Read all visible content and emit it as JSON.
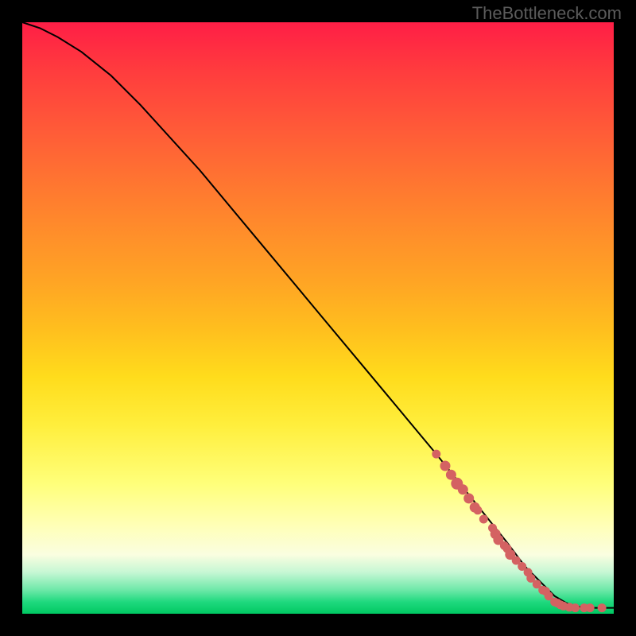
{
  "watermark": "TheBottleneck.com",
  "chart_data": {
    "type": "line",
    "title": "",
    "xlabel": "",
    "ylabel": "",
    "xlim": [
      0,
      100
    ],
    "ylim": [
      0,
      100
    ],
    "curve": {
      "name": "bottleneck-curve",
      "x": [
        0,
        3,
        6,
        10,
        15,
        20,
        30,
        40,
        50,
        60,
        70,
        78,
        82,
        85,
        88,
        90,
        92,
        94,
        96,
        98,
        100
      ],
      "y": [
        100,
        99,
        97.5,
        95,
        91,
        86,
        75,
        63,
        51,
        39,
        27,
        17,
        12,
        8,
        5,
        3,
        1.8,
        1.2,
        1,
        1,
        1
      ]
    },
    "scatter": {
      "name": "sample-points",
      "points": [
        {
          "x": 70,
          "y": 27,
          "r": 5
        },
        {
          "x": 71.5,
          "y": 25,
          "r": 6
        },
        {
          "x": 72.5,
          "y": 23.5,
          "r": 6
        },
        {
          "x": 73.5,
          "y": 22,
          "r": 7
        },
        {
          "x": 74.5,
          "y": 21,
          "r": 6
        },
        {
          "x": 75.5,
          "y": 19.5,
          "r": 6
        },
        {
          "x": 76.5,
          "y": 18,
          "r": 6
        },
        {
          "x": 77,
          "y": 17.5,
          "r": 5
        },
        {
          "x": 78,
          "y": 16,
          "r": 5
        },
        {
          "x": 79.5,
          "y": 14.5,
          "r": 5
        },
        {
          "x": 80,
          "y": 13.5,
          "r": 6
        },
        {
          "x": 80.5,
          "y": 12.5,
          "r": 6
        },
        {
          "x": 81.5,
          "y": 11.5,
          "r": 5
        },
        {
          "x": 82,
          "y": 11,
          "r": 5
        },
        {
          "x": 82.5,
          "y": 10,
          "r": 6
        },
        {
          "x": 83.5,
          "y": 9,
          "r": 5
        },
        {
          "x": 84.5,
          "y": 8,
          "r": 5
        },
        {
          "x": 85.5,
          "y": 7,
          "r": 5
        },
        {
          "x": 86,
          "y": 6,
          "r": 5
        },
        {
          "x": 87,
          "y": 5,
          "r": 5
        },
        {
          "x": 88,
          "y": 4,
          "r": 5
        },
        {
          "x": 88.5,
          "y": 3.8,
          "r": 5
        },
        {
          "x": 89,
          "y": 3,
          "r": 5
        },
        {
          "x": 90,
          "y": 2,
          "r": 5
        },
        {
          "x": 90.5,
          "y": 1.8,
          "r": 5
        },
        {
          "x": 91,
          "y": 1.5,
          "r": 5
        },
        {
          "x": 91.5,
          "y": 1.3,
          "r": 5
        },
        {
          "x": 92.5,
          "y": 1.1,
          "r": 5
        },
        {
          "x": 93.5,
          "y": 1,
          "r": 5
        },
        {
          "x": 95,
          "y": 1,
          "r": 5
        },
        {
          "x": 96,
          "y": 1,
          "r": 5
        },
        {
          "x": 98,
          "y": 1,
          "r": 5
        }
      ]
    },
    "gradient_colors": {
      "top": "#ff1e46",
      "mid_upper": "#ff8f2a",
      "mid": "#ffee3c",
      "mid_lower": "#c6f7d4",
      "bottom": "#00c862"
    }
  }
}
